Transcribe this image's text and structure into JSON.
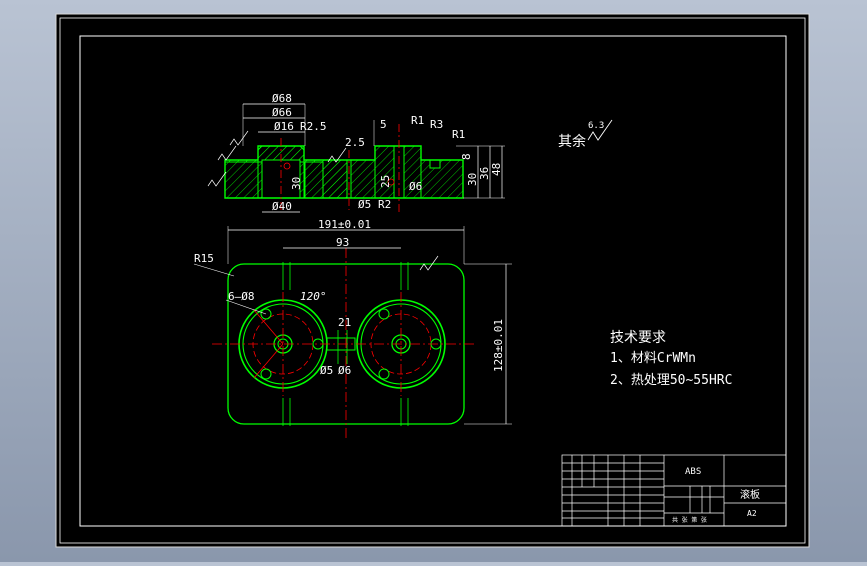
{
  "colors": {
    "background": "#000000",
    "frame": "#ffffff",
    "part": "#00ff00",
    "centerline": "#ff0000",
    "hatch": "#00ff00",
    "text": "#ffffff",
    "dimension": "#ffffff",
    "window_gradient": "#a7b2c4"
  },
  "top_view_dims": {
    "d68": "Ø68",
    "d66": "Ø66",
    "d16": "Ø16",
    "r25": "R2.5",
    "d40": "Ø40",
    "h30": "30",
    "r1a": "R1",
    "r3": "R3",
    "r1b": "R1",
    "five": "5",
    "two_five": "2.5",
    "d6": "Ø6",
    "d5": "Ø5",
    "r2": "R2",
    "h25": "25",
    "h30b": "30",
    "h36": "36",
    "h48": "48",
    "h8": "8"
  },
  "plan_view_dims": {
    "width": "191±0.01",
    "spacing": "93",
    "height": "128±0.01",
    "r15": "R15",
    "holes": "6—Ø8",
    "angle": "120°",
    "d21": "21",
    "d5": "Ø5",
    "d6": "Ø6"
  },
  "roughness": {
    "remaining_label": "其余",
    "value": "6.3"
  },
  "notes": {
    "title": "技术要求",
    "items": [
      "1、材料CrWMn",
      "2、热处理50~55HRC"
    ]
  },
  "title_block": {
    "company": "ABS",
    "part_name": "滚板",
    "drawing_no": "A2",
    "table_label": "共 张 第 张"
  }
}
